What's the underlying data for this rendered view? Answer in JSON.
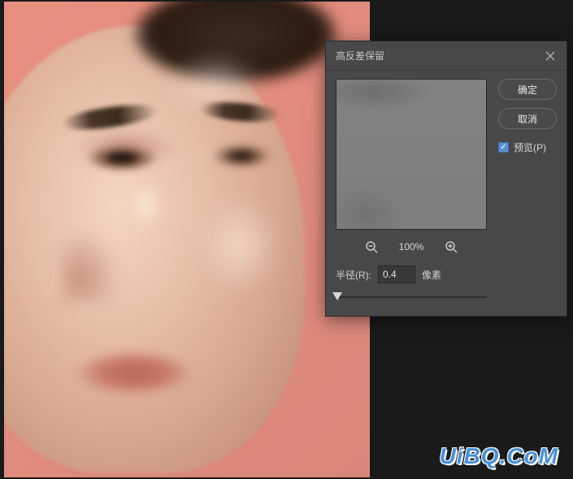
{
  "watermark": "UiBQ.CoM",
  "dialog": {
    "title": "高反差保留",
    "ok_label": "确定",
    "cancel_label": "取消",
    "preview_label": "预览(P)",
    "preview_checked": true,
    "zoom_percent": "100%",
    "radius_label": "半径(R):",
    "radius_value": "0.4",
    "radius_unit": "像素"
  }
}
